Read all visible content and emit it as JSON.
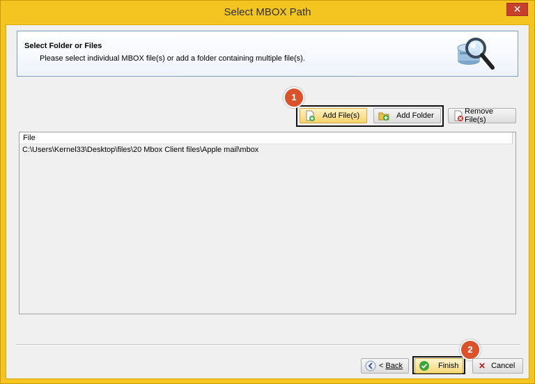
{
  "window": {
    "title": "Select MBOX Path",
    "close_label": "✕"
  },
  "header": {
    "title": "Select Folder or Files",
    "description": "Please select individual MBOX file(s) or add a folder containing multiple file(s)."
  },
  "toolbar": {
    "add_files_label": "Add File(s)",
    "add_folder_label": "Add Folder",
    "remove_files_label": "Remove File(s)"
  },
  "file_list": {
    "column_header": "File",
    "rows": [
      "C:\\Users\\Kernel33\\Desktop\\files\\20 Mbox Client files\\Apple mail\\mbox"
    ]
  },
  "footer": {
    "back_prefix": "< ",
    "back_label": "Back",
    "finish_label": "Finish",
    "cancel_label": "Cancel"
  },
  "annotations": {
    "step1": "1",
    "step2": "2"
  },
  "colors": {
    "window_frame": "#f4c521",
    "callout_badge": "#d9522c"
  }
}
